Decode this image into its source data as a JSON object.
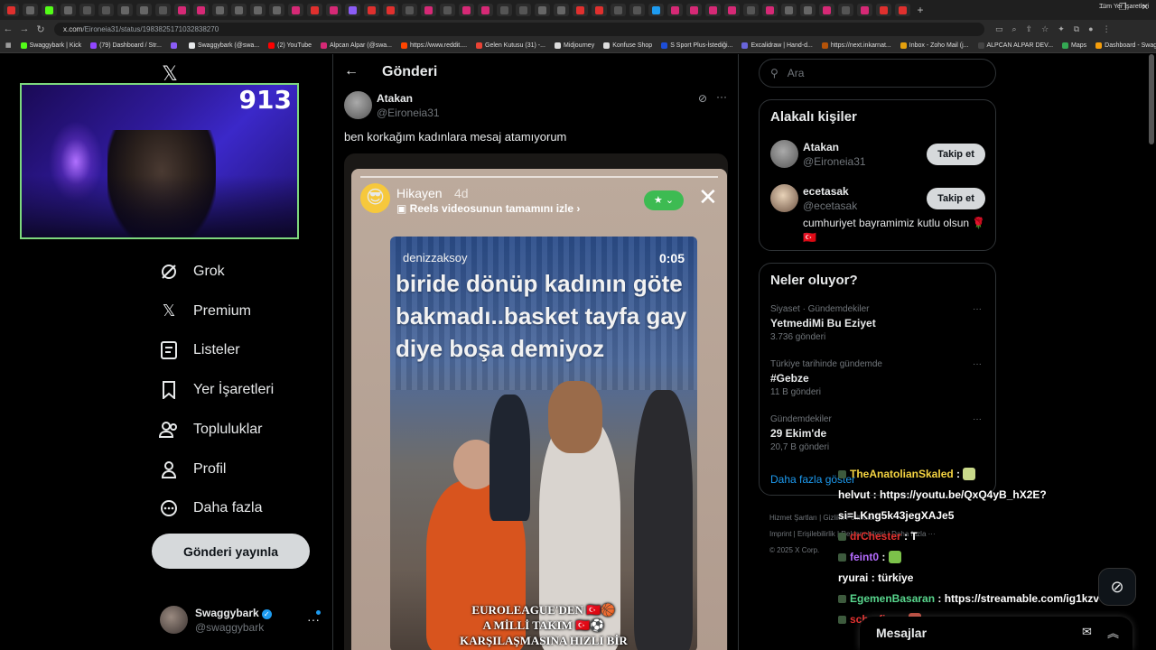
{
  "browser": {
    "tabs": [
      {
        "color": "#e0302e"
      },
      {
        "color": "#666"
      },
      {
        "color": "#53fc18"
      },
      {
        "color": "#666"
      },
      {
        "color": "#555"
      },
      {
        "color": "#555"
      },
      {
        "color": "#666"
      },
      {
        "color": "#666"
      },
      {
        "color": "#555"
      },
      {
        "color": "#d62976"
      },
      {
        "color": "#d62976"
      },
      {
        "color": "#666"
      },
      {
        "color": "#666"
      },
      {
        "color": "#666"
      },
      {
        "color": "#666"
      },
      {
        "color": "#d62976"
      },
      {
        "color": "#e0302e"
      },
      {
        "color": "#d62976"
      },
      {
        "color": "#8b5cf6"
      },
      {
        "color": "#e0302e"
      },
      {
        "color": "#e0302e"
      },
      {
        "color": "#555"
      },
      {
        "color": "#d62976"
      },
      {
        "color": "#555"
      },
      {
        "color": "#d62976"
      },
      {
        "color": "#d62976"
      },
      {
        "color": "#555"
      },
      {
        "color": "#555"
      },
      {
        "color": "#666"
      },
      {
        "color": "#666"
      },
      {
        "color": "#e0302e"
      },
      {
        "color": "#e0302e"
      },
      {
        "color": "#555"
      },
      {
        "color": "#555"
      },
      {
        "color": "#1d9bf0"
      },
      {
        "color": "#d62976"
      },
      {
        "color": "#d62976"
      },
      {
        "color": "#d62976"
      },
      {
        "color": "#d62976"
      },
      {
        "color": "#555"
      },
      {
        "color": "#d62976"
      },
      {
        "color": "#666"
      },
      {
        "color": "#666"
      },
      {
        "color": "#d62976"
      },
      {
        "color": "#555"
      },
      {
        "color": "#d62976"
      },
      {
        "color": "#e0302e"
      },
      {
        "color": "#e0302e"
      }
    ],
    "url_host": "x.com",
    "url_path": "/Eironeia31/status/1983825171032838270",
    "bookmarks": [
      {
        "label": "Swaggybark | Kick",
        "color": "#53fc18"
      },
      {
        "label": "(79) Dashboard / Str...",
        "color": "#9146ff"
      },
      {
        "label": "",
        "color": "#8b5cf6"
      },
      {
        "label": "Swaggybark (@swa...",
        "color": "#e7e9ea"
      },
      {
        "label": "(2) YouTube",
        "color": "#ff0000"
      },
      {
        "label": "Alpcan Alpar (@swa...",
        "color": "#d62976"
      },
      {
        "label": "https://www.reddit....",
        "color": "#ff4500"
      },
      {
        "label": "Gelen Kutusu (31) -...",
        "color": "#ea4335"
      },
      {
        "label": "Midjourney",
        "color": "#ddd"
      },
      {
        "label": "Konfuse Shop",
        "color": "#ddd"
      },
      {
        "label": "S Sport Plus-İstediği...",
        "color": "#1d4ed8"
      },
      {
        "label": "Excalidraw | Hand-d...",
        "color": "#6965db"
      },
      {
        "label": "https://next.inkarnat...",
        "color": "#b45309"
      },
      {
        "label": "Inbox - Zoho Mail (j...",
        "color": "#e5a00d"
      },
      {
        "label": "ALPCAN ALPAR DEV...",
        "color": "#444"
      },
      {
        "label": "Maps",
        "color": "#34a853"
      },
      {
        "label": "Dashboard - Swagg...",
        "color": "#f59e0b"
      }
    ],
    "all_bookmarks": "Tüm Yer İşaretleri"
  },
  "webcam": {
    "count": "913"
  },
  "nav": {
    "items": [
      {
        "label": "Grok",
        "icon": "grok-icon"
      },
      {
        "label": "Premium",
        "icon": "x-icon"
      },
      {
        "label": "Listeler",
        "icon": "list-icon"
      },
      {
        "label": "Yer İşaretleri",
        "icon": "bookmark-icon"
      },
      {
        "label": "Topluluklar",
        "icon": "people-icon"
      },
      {
        "label": "Profil",
        "icon": "person-icon"
      },
      {
        "label": "Daha fazla",
        "icon": "more-circle-icon"
      }
    ],
    "post_button": "Gönderi yayınla"
  },
  "account": {
    "name": "Swaggybark",
    "handle": "@swaggybark"
  },
  "main": {
    "title": "Gönderi",
    "tweet": {
      "name": "Atakan",
      "handle": "@Eironeia31",
      "text": "ben korkağım kadınlara mesaj atamıyorum"
    },
    "story": {
      "user": "Hikayen",
      "time": "4d",
      "reels": "Reels videosunun tamamını izle ›"
    },
    "reel": {
      "user": "denizzaksoy",
      "time": "0:05",
      "caption": "biride dönüp kadının göte bakmadı..basket tayfa gay diye boşa demiyoz",
      "footer_1": "EUROLEAGUE'DEN 🇹🇷🏀",
      "footer_2": "A MİLLİ TAKIM 🇹🇷⚽",
      "footer_3": "KARŞILAŞMASINA HIZLI BİR"
    }
  },
  "search": {
    "placeholder": "Ara"
  },
  "people": {
    "title": "Alakalı kişiler",
    "list": [
      {
        "name": "Atakan",
        "handle": "@Eironeia31",
        "follow": "Takip et"
      },
      {
        "name": "ecetasak",
        "handle": "@ecetasak",
        "follow": "Takip et",
        "bio": "cumhuriyet bayramimiz kutlu olsun 🌹🇹🇷"
      }
    ]
  },
  "trends": {
    "title": "Neler oluyor?",
    "items": [
      {
        "context": "Siyaset · Gündemdekiler",
        "name": "YetmediMi Bu Eziyet",
        "count": "3.736 gönderi"
      },
      {
        "context": "Türkiye tarihinde gündemde",
        "name": "#Gebze",
        "count": "11 B gönderi"
      },
      {
        "context": "Gündemdekiler",
        "name": "29 Ekim'de",
        "count": "20,7 B gönderi"
      }
    ],
    "show_more": "Daha fazla göster"
  },
  "footer": {
    "line1": "Hizmet Şartları  |  Gizlilik Politikası  |",
    "line2": "Imprint  |  Erişilebilirlik  |  Reklam bilgisi  |  Daha fazla ···",
    "line3": "© 2025 X Corp."
  },
  "chat": [
    {
      "user": "TheAnatolianSkaled",
      "message": "",
      "color": "#f5d442"
    },
    {
      "user": "helvut",
      "message": "https://youtu.be/QxQ4yB_hX2E?",
      "color": "#ffffff"
    },
    {
      "user": "",
      "message": "si=LKng5k43jegXAJe5",
      "color": "#ffffff"
    },
    {
      "user": "drChester",
      "message": "T",
      "color": "#e0302e"
    },
    {
      "user": "feint0",
      "message": "",
      "color": "#b56cff"
    },
    {
      "user": "ryurai",
      "message": "türkiye",
      "color": "#ffffff"
    },
    {
      "user": "EgemenBasaran",
      "message": "https://streamable.com/ig1kzv",
      "color": "#58d68d"
    },
    {
      "user": "scharfion",
      "message": "",
      "color": "#e0302e"
    }
  ],
  "messages": {
    "title": "Mesajlar"
  }
}
